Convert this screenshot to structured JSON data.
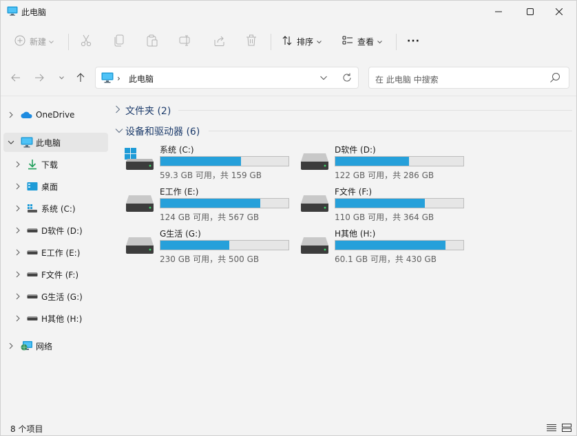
{
  "window": {
    "title": "此电脑"
  },
  "toolbar": {
    "new_label": "新建",
    "sort_label": "排序",
    "view_label": "查看",
    "more_label": "···"
  },
  "address": {
    "separator": "›",
    "crumb": "此电脑"
  },
  "search": {
    "placeholder": "在 此电脑 中搜索"
  },
  "sidebar": {
    "items": [
      {
        "label": "OneDrive",
        "icon": "onedrive-icon"
      },
      {
        "label": "此电脑",
        "icon": "this-pc-icon",
        "selected": true
      },
      {
        "label": "下载",
        "icon": "download-icon"
      },
      {
        "label": "桌面",
        "icon": "desktop-icon"
      },
      {
        "label": "系统 (C:)",
        "icon": "windows-drive-icon"
      },
      {
        "label": "D软件 (D:)",
        "icon": "drive-icon"
      },
      {
        "label": "E工作 (E:)",
        "icon": "drive-icon"
      },
      {
        "label": "F文件 (F:)",
        "icon": "drive-icon"
      },
      {
        "label": "G生活 (G:)",
        "icon": "drive-icon"
      },
      {
        "label": "H其他 (H:)",
        "icon": "drive-icon"
      },
      {
        "label": "网络",
        "icon": "network-icon"
      }
    ]
  },
  "main": {
    "folders_header": "文件夹 (2)",
    "drives_header": "设备和驱动器 (6)",
    "drives": [
      {
        "name": "系统 (C:)",
        "free_text": "59.3 GB 可用，共 159 GB",
        "used_fraction": 0.627
      },
      {
        "name": "D软件 (D:)",
        "free_text": "122 GB 可用，共 286 GB",
        "used_fraction": 0.573
      },
      {
        "name": "E工作 (E:)",
        "free_text": "124 GB 可用，共 567 GB",
        "used_fraction": 0.781
      },
      {
        "name": "F文件 (F:)",
        "free_text": "110 GB 可用，共 364 GB",
        "used_fraction": 0.698
      },
      {
        "name": "G生活 (G:)",
        "free_text": "230 GB 可用，共 500 GB",
        "used_fraction": 0.54
      },
      {
        "name": "H其他 (H:)",
        "free_text": "60.1 GB 可用，共 430 GB",
        "used_fraction": 0.86
      }
    ]
  },
  "status": {
    "count": "8 个项目"
  },
  "colors": {
    "accent": "#26a0da",
    "selected_bg": "#e6e6e6",
    "group_title": "#1c3b6b"
  }
}
